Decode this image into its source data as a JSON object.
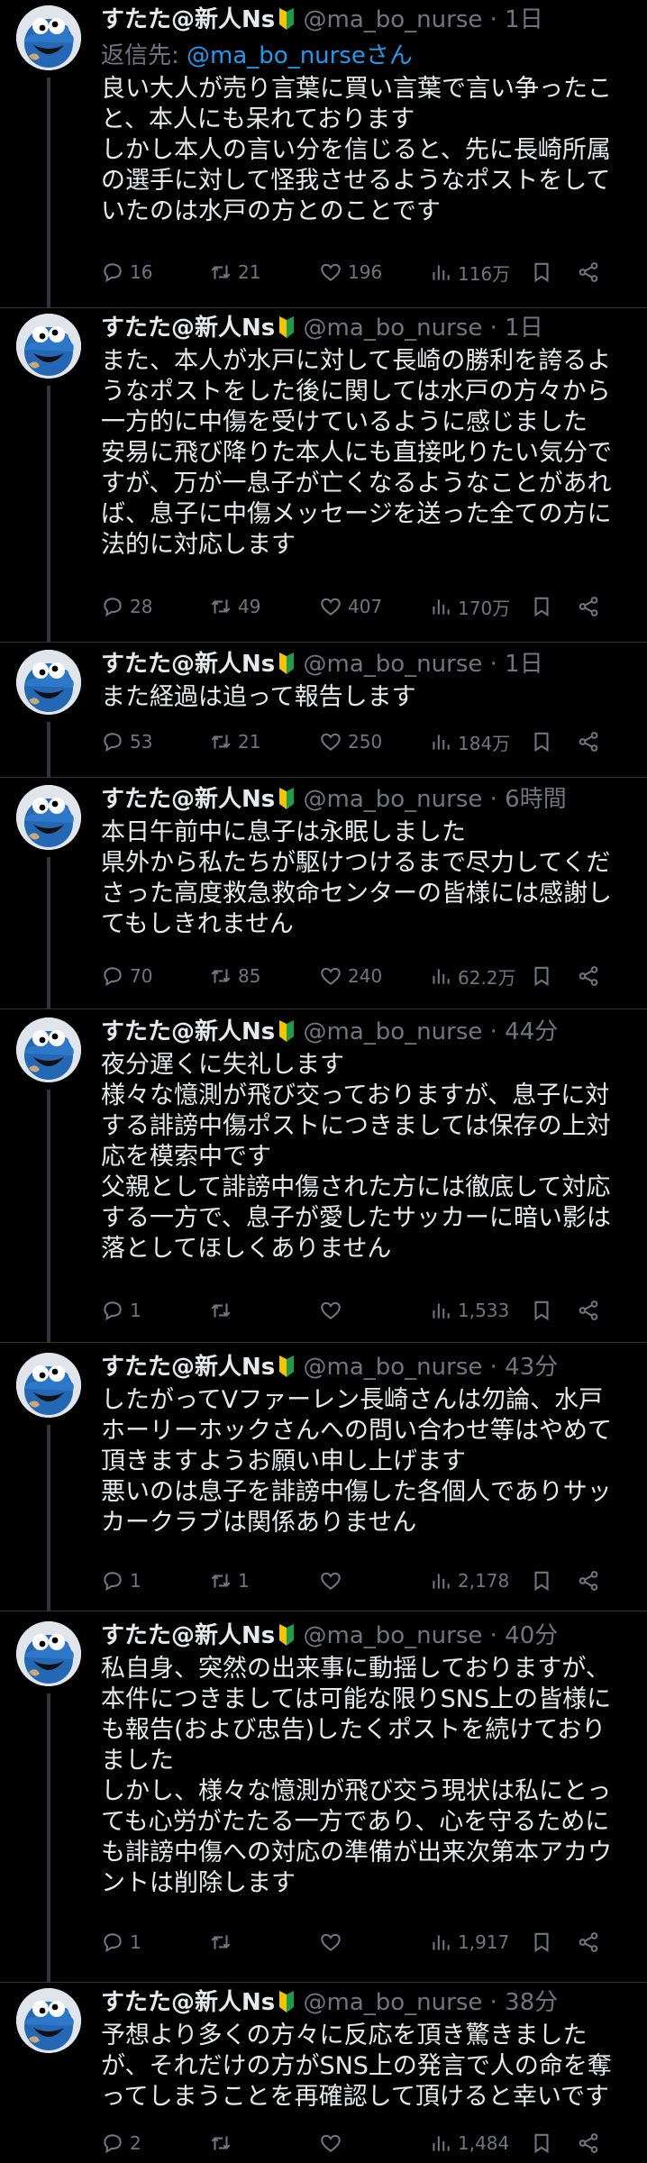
{
  "author": {
    "name": "すたた@新人Ns",
    "handle": "@ma_bo_nurse",
    "dot": "·"
  },
  "tweets": [
    {
      "time": "1日",
      "reply_to_label": "返信先: ",
      "reply_to_handle": "@ma_bo_nurseさん",
      "text": "良い大人が売り言葉に買い言葉で言い争ったこと、本人にも呆れております\nしかし本人の言い分を信じると、先に長崎所属の選手に対して怪我させるようなポストをしていたのは水戸の方とのことです",
      "replies": "16",
      "retweets": "21",
      "likes": "196",
      "views": "116万"
    },
    {
      "time": "1日",
      "text": "また、本人が水戸に対して長崎の勝利を誇るようなポストをした後に関しては水戸の方々から一方的に中傷を受けているように感じました\n安易に飛び降りた本人にも直接叱りたい気分ですが、万が一息子が亡くなるようなことがあれば、息子に中傷メッセージを送った全ての方に法的に対応します",
      "replies": "28",
      "retweets": "49",
      "likes": "407",
      "views": "170万"
    },
    {
      "time": "1日",
      "text": "また経過は追って報告します",
      "replies": "53",
      "retweets": "21",
      "likes": "250",
      "views": "184万"
    },
    {
      "time": "6時間",
      "text": "本日午前中に息子は永眠しました\n県外から私たちが駆けつけるまで尽力してくださった高度救急救命センターの皆様には感謝してもしきれません",
      "replies": "70",
      "retweets": "85",
      "likes": "240",
      "views": "62.2万"
    },
    {
      "time": "44分",
      "text": "夜分遅くに失礼します\n様々な憶測が飛び交っておりますが、息子に対する誹謗中傷ポストにつきましては保存の上対応を模索中です\n父親として誹謗中傷された方には徹底して対応する一方で、息子が愛したサッカーに暗い影は落としてほしくありません",
      "replies": "1",
      "retweets": "",
      "likes": "",
      "views": "1,533"
    },
    {
      "time": "43分",
      "text": "したがってVファーレン長崎さんは勿論、水戸ホーリーホックさんへの問い合わせ等はやめて頂きますようお願い申し上げます\n悪いのは息子を誹謗中傷した各個人でありサッカークラブは関係ありません",
      "replies": "1",
      "retweets": "1",
      "likes": "",
      "views": "2,178"
    },
    {
      "time": "40分",
      "text": "私自身、突然の出来事に動揺しておりますが、本件につきましては可能な限りSNS上の皆様にも報告(および忠告)したくポストを続けておりました\nしかし、様々な憶測が飛び交う現状は私にとっても心労がたたる一方であり、心を守るためにも誹謗中傷への対応の準備が出来次第本アカウントは削除します",
      "replies": "1",
      "retweets": "",
      "likes": "",
      "views": "1,917"
    },
    {
      "time": "38分",
      "text": "予想より多くの方々に反応を頂き驚きましたが、それだけの方がSNS上の発言で人の命を奪ってしまうことを再確認して頂けると幸いです",
      "replies": "2",
      "retweets": "",
      "likes": "",
      "views": "1,484"
    }
  ],
  "colors": {
    "background": "#000000",
    "text": "#e7e9ea",
    "secondary": "#71767b",
    "link": "#1d9bf0",
    "avatar_blue": "#1f5fa8",
    "divider": "#2f3336"
  },
  "icons": {
    "reply": "speech-bubble-icon",
    "retweet": "retweet-icon",
    "like": "heart-icon",
    "views": "bar-chart-icon",
    "bookmark": "bookmark-icon",
    "share": "share-icon",
    "badge": "beginner-mark-icon"
  }
}
